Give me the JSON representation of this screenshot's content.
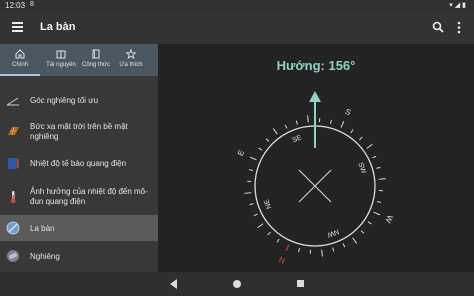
{
  "status": {
    "time": "12:03",
    "sim": "8"
  },
  "appbar": {
    "title": "La bàn"
  },
  "tabs": [
    {
      "label": "Chính",
      "icon": "home-icon"
    },
    {
      "label": "Tài nguyên",
      "icon": "book-open-icon"
    },
    {
      "label": "Công thức",
      "icon": "notebook-icon"
    },
    {
      "label": "Ưa thích",
      "icon": "star-icon"
    }
  ],
  "nav": [
    {
      "label": "Góc nghiêng tối ưu",
      "icon": "angle-icon"
    },
    {
      "label": "Bức xạ mặt trời trên bề mặt nghiêng",
      "icon": "solar-panel-icon"
    },
    {
      "label": "Nhiệt độ tế bào quang điện",
      "icon": "pv-cell-icon"
    },
    {
      "label": "Ảnh hưởng của nhiệt độ đến mô-đun quang điện",
      "icon": "thermometer-icon"
    },
    {
      "label": "La bàn",
      "icon": "compass-icon"
    },
    {
      "label": "Nghiêng",
      "icon": "level-icon"
    }
  ],
  "compass": {
    "heading_label": "Hướng: 156°",
    "heading_deg": 156,
    "directions": [
      "N",
      "NE",
      "E",
      "SE",
      "S",
      "SW",
      "W",
      "NW"
    ],
    "colors": {
      "accent": "#8fd1c4",
      "north": "#e0443a"
    }
  }
}
